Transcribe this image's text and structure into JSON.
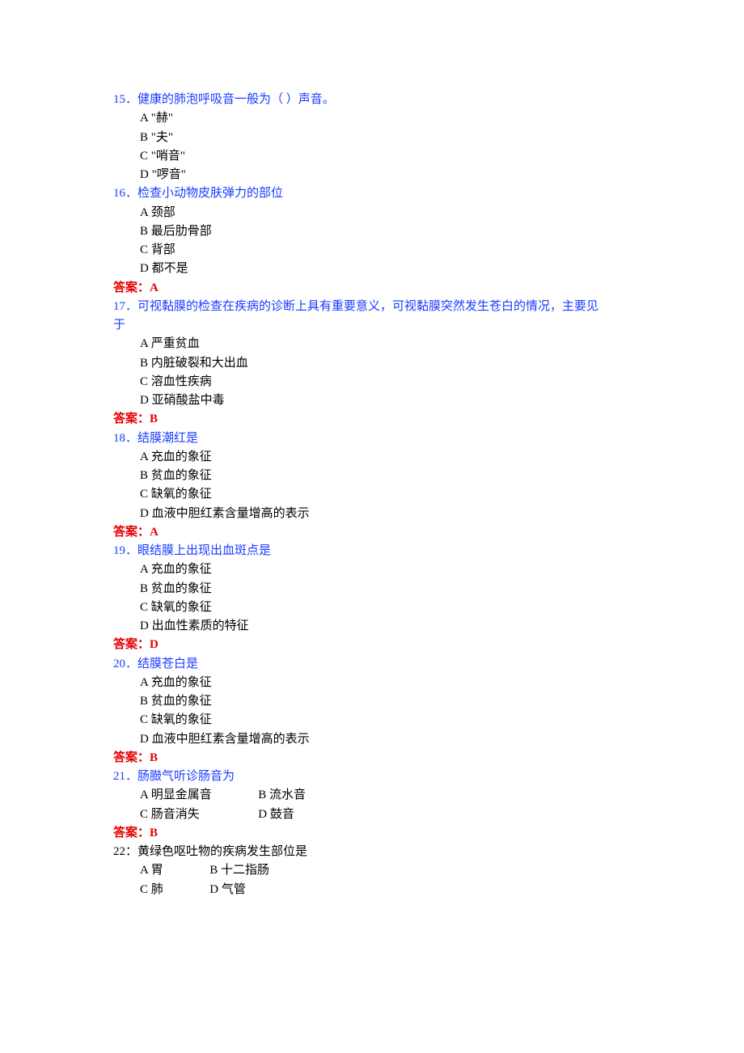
{
  "q15": {
    "text": "15．健康的肺泡呼吸音一般为（  ）声音。",
    "A": "A \"赫\"",
    "B": "B \"夫\"",
    "C": "C \"哨音\"",
    "D": "D \"啰音\""
  },
  "q16": {
    "text": "16．检查小动物皮肤弹力的部位",
    "A": "A  颈部",
    "B": "B  最后肋骨部",
    "C": "C  背部",
    "D": "D  都不是",
    "ans": "答案：A"
  },
  "q17": {
    "line1": "17．可视黏膜的检查在疾病的诊断上具有重要意义，可视黏膜突然发生苍白的情况，主要见",
    "line2": "于",
    "A": "A  严重贫血",
    "B": "B  内脏破裂和大出血",
    "C": "C  溶血性疾病",
    "D": "D  亚硝酸盐中毒",
    "ans": "答案：B"
  },
  "q18": {
    "text": "18．结膜潮红是",
    "A": "A  充血的象征",
    "B": "B  贫血的象征",
    "C": "C  缺氧的象征",
    "D": "D  血液中胆红素含量增高的表示",
    "ans": "答案：A"
  },
  "q19": {
    "text": "19．眼结膜上出现出血斑点是",
    "A": "A  充血的象征",
    "B": "B  贫血的象征",
    "C": "C  缺氧的象征",
    "D": "D  出血性素质的特征",
    "ans": "答案：D"
  },
  "q20": {
    "text": "20．结膜苍白是",
    "A": "A  充血的象征",
    "B": "B  贫血的象征",
    "C": "C  缺氧的象征",
    "D": "D  血液中胆红素含量增高的表示",
    "ans": "答案：B"
  },
  "q21": {
    "text": "21．肠臌气听诊肠音为",
    "row1A": "A  明显金属音",
    "row1B": "B  流水音",
    "row2C": "C  肠音消失",
    "row2D": "D  鼓音",
    "ans": "答案：B"
  },
  "q22": {
    "text": "22：黄绿色呕吐物的疾病发生部位是",
    "row1A": "A  胃",
    "row1B": "B  十二指肠",
    "row2C": "C  肺",
    "row2D": "D  气管"
  }
}
